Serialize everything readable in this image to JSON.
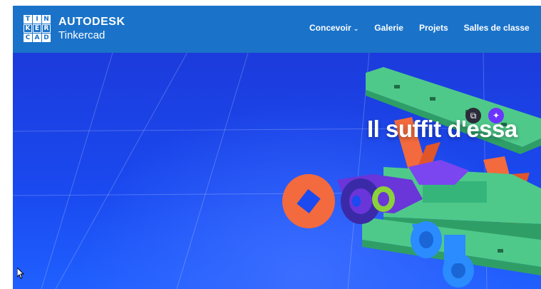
{
  "logo": {
    "grid_letters": [
      "T",
      "I",
      "N",
      "K",
      "E",
      "R",
      "C",
      "A",
      "D"
    ],
    "brand_top": "AUTODESK",
    "brand_bottom": "Tinkercad"
  },
  "nav": {
    "items": [
      {
        "label": "Concevoir",
        "has_dropdown": true
      },
      {
        "label": "Galerie"
      },
      {
        "label": "Projets"
      },
      {
        "label": "Salles de classe"
      }
    ]
  },
  "hero": {
    "headline": "Il suffit d'essa",
    "icons": [
      "copy-window-icon",
      "sparkle-ai-icon"
    ]
  },
  "colors": {
    "navbar": "#1a73c9",
    "hero_bg": "#1a4af0",
    "plane_green": "#4fc98a",
    "plane_orange": "#f26a3d",
    "plane_purple": "#6a35d9",
    "plane_blue": "#2a8cff"
  }
}
